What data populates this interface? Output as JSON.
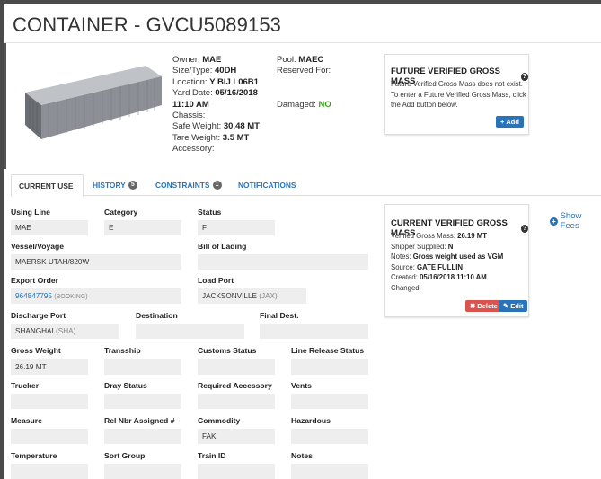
{
  "title": "CONTAINER - GVCU5089153",
  "details": {
    "owner_label": "Owner:",
    "owner": "MAE",
    "size_label": "Size/Type:",
    "size": "40DH",
    "location_label": "Location:",
    "location": "Y BIJ L06B1",
    "yard_date_label": "Yard Date:",
    "yard_date": "05/16/2018",
    "yard_time": "11:10 AM",
    "chassis_label": "Chassis:",
    "safe_weight_label": "Safe Weight:",
    "safe_weight": "30.48 MT",
    "tare_weight_label": "Tare Weight:",
    "tare_weight": "3.5 MT",
    "accessory_label": "Accessory:",
    "pool_label": "Pool:",
    "pool": "MAEC",
    "reserved_label": "Reserved For:",
    "damaged_label": "Damaged:",
    "damaged": "NO"
  },
  "future_vgm": {
    "title": "FUTURE VERIFIED GROSS MASS",
    "line1": "Future Verified Gross Mass does not exist.",
    "line2": "To enter a Future Verified Gross Mass, click",
    "line3": "the Add button below.",
    "add_label": "Add"
  },
  "tabs": [
    {
      "label": "CURRENT USE"
    },
    {
      "label": "HISTORY",
      "badge": "5"
    },
    {
      "label": "CONSTRAINTS",
      "badge": "1"
    },
    {
      "label": "NOTIFICATIONS"
    }
  ],
  "fields": {
    "using_line": {
      "label": "Using Line",
      "value": "MAE"
    },
    "category": {
      "label": "Category",
      "value": "E"
    },
    "status": {
      "label": "Status",
      "value": "F"
    },
    "vessel": {
      "label": "Vessel/Voyage",
      "value": "MAERSK UTAH/820W"
    },
    "bol": {
      "label": "Bill of Lading",
      "value": ""
    },
    "export_order": {
      "label": "Export Order",
      "value": "964847795",
      "suffix": "(BOOKING)"
    },
    "load_port": {
      "label": "Load Port",
      "value": "JACKSONVILLE",
      "suffix": "(JAX)"
    },
    "discharge_port": {
      "label": "Discharge Port",
      "value": "SHANGHAI",
      "suffix": "(SHA)"
    },
    "destination": {
      "label": "Destination",
      "value": ""
    },
    "final_dest": {
      "label": "Final Dest.",
      "value": ""
    },
    "gross_weight": {
      "label": "Gross Weight",
      "value": "26.19 MT"
    },
    "transship": {
      "label": "Transship",
      "value": ""
    },
    "customs_status": {
      "label": "Customs Status",
      "value": ""
    },
    "line_release": {
      "label": "Line Release Status",
      "value": ""
    },
    "trucker": {
      "label": "Trucker",
      "value": ""
    },
    "dray_status": {
      "label": "Dray Status",
      "value": ""
    },
    "required_accessory": {
      "label": "Required Accessory",
      "value": ""
    },
    "vents": {
      "label": "Vents",
      "value": ""
    },
    "measure": {
      "label": "Measure",
      "value": ""
    },
    "rel_nbr": {
      "label": "Rel Nbr Assigned #",
      "value": ""
    },
    "commodity": {
      "label": "Commodity",
      "value": "FAK"
    },
    "hazardous": {
      "label": "Hazardous",
      "value": ""
    },
    "temperature": {
      "label": "Temperature",
      "value": ""
    },
    "sort_group": {
      "label": "Sort Group",
      "value": ""
    },
    "train_id": {
      "label": "Train ID",
      "value": ""
    },
    "notes": {
      "label": "Notes",
      "value": ""
    }
  },
  "current_vgm": {
    "title": "CURRENT VERIFIED GROSS MASS",
    "vgm_label": "Verified Gross Mass:",
    "vgm": "26.19 MT",
    "shipper_label": "Shipper Supplied:",
    "shipper": "N",
    "notes_label": "Notes:",
    "notes": "Gross weight used as VGM",
    "source_label": "Source:",
    "source": "GATE FULLIN",
    "created_label": "Created:",
    "created": "05/16/2018 11:10 AM",
    "changed_label": "Changed:",
    "delete_label": "Delete",
    "edit_label": "Edit"
  },
  "show_fees_label": "Show Fees",
  "colors": {
    "link": "#2a73b8",
    "delete": "#d9534f",
    "ok": "#3a9d23",
    "field_bg": "#eeeeee"
  },
  "icons": [
    "question-circle-icon",
    "plus-icon",
    "close-icon",
    "pencil-icon",
    "plus-circle-icon"
  ]
}
